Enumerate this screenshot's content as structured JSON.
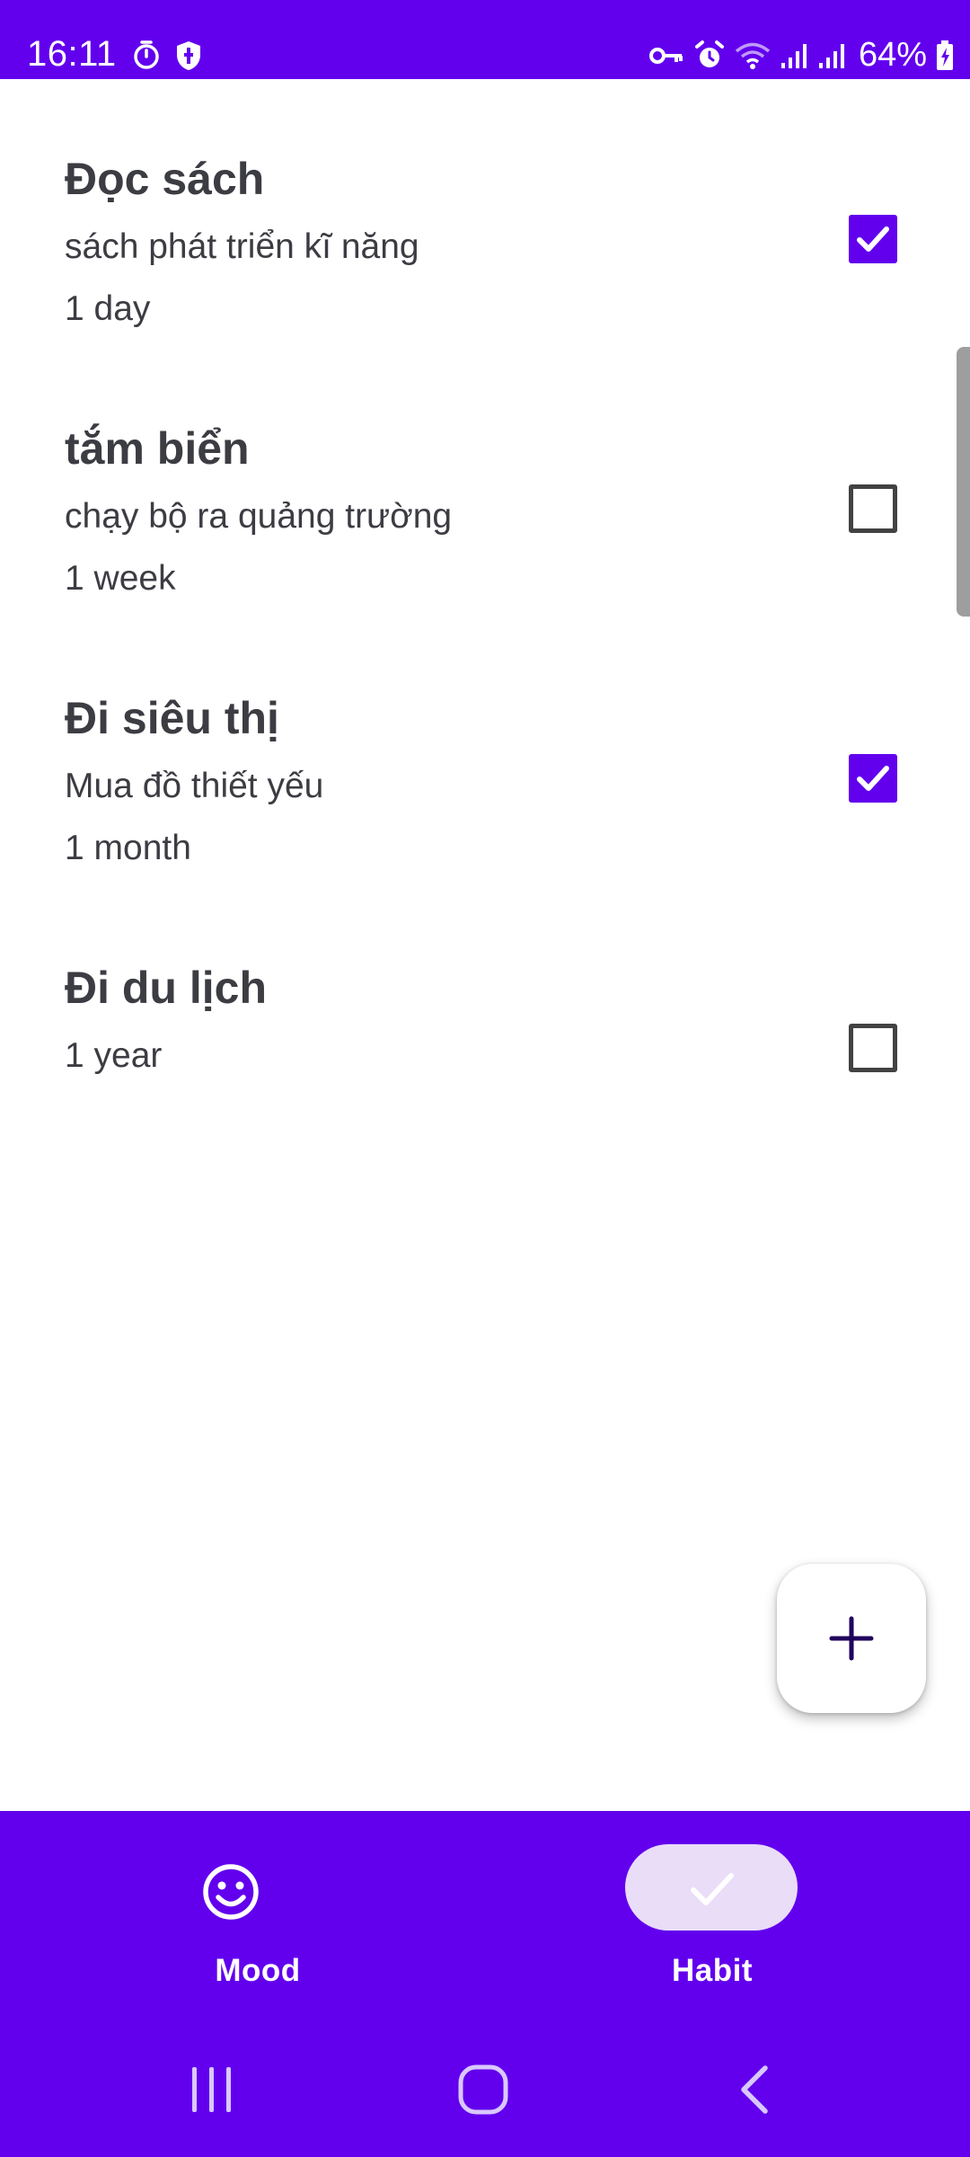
{
  "status_bar": {
    "time": "16:11",
    "battery": "64%",
    "icons_left": [
      "timer-icon",
      "shield-icon"
    ],
    "icons_right": [
      "vpn-key-icon",
      "alarm-icon",
      "wifi-icon",
      "signal-icon",
      "signal-icon",
      "battery-charging-icon"
    ]
  },
  "habits": [
    {
      "title": "Đọc sách",
      "lines": [
        "sách phát triển kĩ năng",
        "1 day"
      ],
      "checked": true
    },
    {
      "title": "tắm biển",
      "lines": [
        "chạy bộ ra quảng trường",
        "1 week"
      ],
      "checked": false
    },
    {
      "title": "Đi siêu thị",
      "lines": [
        "Mua đồ thiết yếu",
        "1 month"
      ],
      "checked": true
    },
    {
      "title": "Đi du lịch",
      "lines": [
        "1 year"
      ],
      "checked": false
    }
  ],
  "fab": {
    "icon": "plus-icon"
  },
  "bottom_nav": {
    "items": [
      {
        "label": "Mood",
        "icon": "smiley-icon",
        "selected": false
      },
      {
        "label": "Habit",
        "icon": "check-icon",
        "selected": true
      }
    ]
  },
  "system_nav": {
    "icons": [
      "recents-icon",
      "home-icon",
      "back-icon"
    ]
  },
  "colors": {
    "primary": "#6200EE",
    "checkbox_checked": "#6200EE",
    "text": "#3c3c43",
    "nav_pill": "#e9ddf8"
  }
}
